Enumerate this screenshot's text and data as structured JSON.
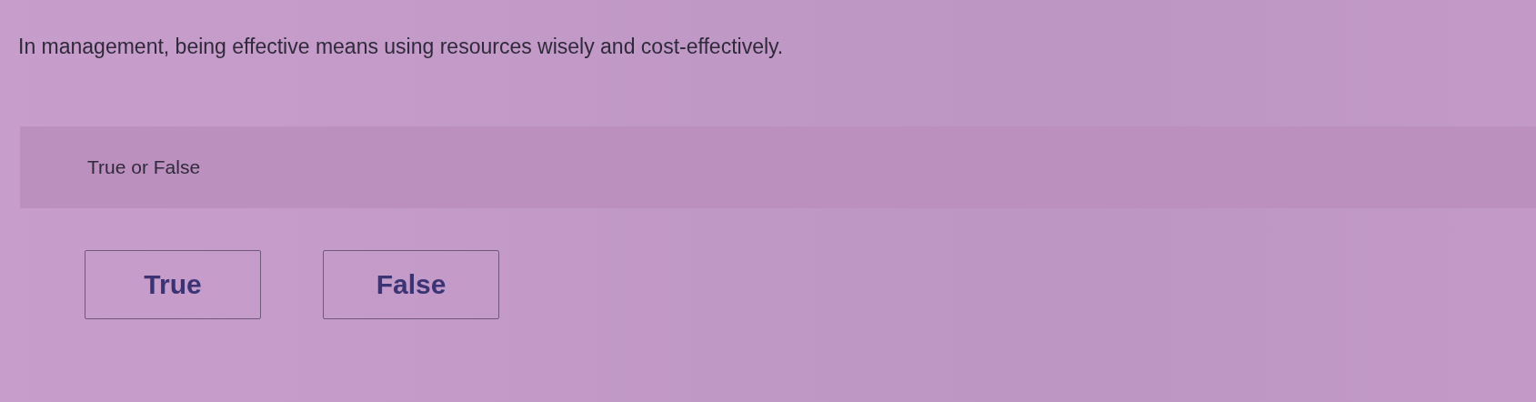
{
  "question": "In management, being effective means using resources wisely and cost-effectively.",
  "prompt": "True or False",
  "options": [
    {
      "label": "True",
      "selected": false
    },
    {
      "label": "False",
      "selected": false
    }
  ]
}
